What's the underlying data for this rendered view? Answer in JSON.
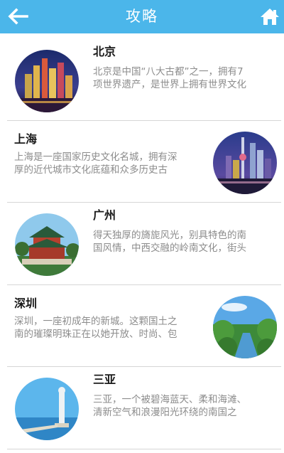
{
  "header": {
    "title": "攻略",
    "back_icon": "arrow-left-icon",
    "home_icon": "home-icon",
    "background": "#4bb6ea"
  },
  "items": [
    {
      "name": "北京",
      "desc_line1": "北京是中国“八大古都”之一，拥有7",
      "desc_line2": "项世界遗产，是世界上拥有世界文化",
      "image": "beijing-skyline-night"
    },
    {
      "name": "上海",
      "desc_line1": "上海是一座国家历史文化名城，拥有深",
      "desc_line2": "厚的近代城市文化底蕴和众多历史古",
      "image": "shanghai-skyline-night"
    },
    {
      "name": "广州",
      "desc_line1": "得天独厚的旖旎风光，别具特色的南",
      "desc_line2": "国风情，中西交融的岭南文化，街头",
      "image": "guangzhou-pavilion"
    },
    {
      "name": "深圳",
      "desc_line1": "深圳，一座初成年的新城。这颗国土之",
      "desc_line2": "南的璀璨明珠正在以她开放、时尚、包",
      "image": "shenzhen-green-river"
    },
    {
      "name": "三亚",
      "desc_line1": "三亚，一个被碧海蓝天、柔和海滩、",
      "desc_line2": "清新空气和浪漫阳光环绕的南国之",
      "image": "sanya-seaside-statue"
    }
  ]
}
